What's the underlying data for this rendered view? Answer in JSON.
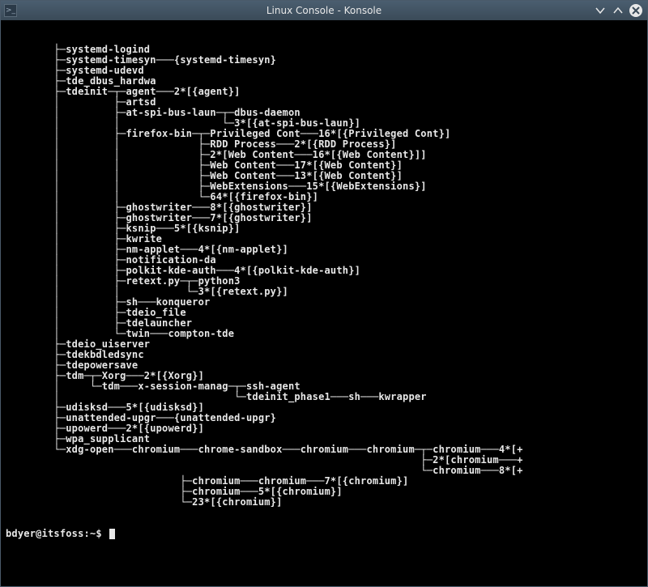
{
  "window": {
    "title": "Linux Console - Konsole",
    "icon_label": ">_"
  },
  "terminal": {
    "prompt": "bdyer@itsfoss:~$ ",
    "lines": [
      "        ├─systemd-logind",
      "        ├─systemd-timesyn───{systemd-timesyn}",
      "        ├─systemd-udevd",
      "        ├─tde_dbus_hardwa",
      "        ├─tdeinit─┬─agent───2*[{agent}]",
      "        │         ├─artsd",
      "        │         ├─at-spi-bus-laun─┬─dbus-daemon",
      "        │         │                 └─3*[{at-spi-bus-laun}]",
      "        │         ├─firefox-bin─┬─Privileged Cont───16*[{Privileged Cont}]",
      "        │         │             ├─RDD Process───2*[{RDD Process}]",
      "        │         │             ├─2*[Web Content───16*[{Web Content}]]",
      "        │         │             ├─Web Content───17*[{Web Content}]",
      "        │         │             ├─Web Content───13*[{Web Content}]",
      "        │         │             ├─WebExtensions───15*[{WebExtensions}]",
      "        │         │             └─64*[{firefox-bin}]",
      "        │         ├─ghostwriter───8*[{ghostwriter}]",
      "        │         ├─ghostwriter───7*[{ghostwriter}]",
      "        │         ├─ksnip───5*[{ksnip}]",
      "        │         ├─kwrite",
      "        │         ├─nm-applet───4*[{nm-applet}]",
      "        │         ├─notification-da",
      "        │         ├─polkit-kde-auth───4*[{polkit-kde-auth}]",
      "        │         ├─retext.py─┬─python3",
      "        │         │           └─3*[{retext.py}]",
      "        │         ├─sh───konqueror",
      "        │         ├─tdeio_file",
      "        │         ├─tdelauncher",
      "        │         └─twin───compton-tde",
      "        ├─tdeio_uiserver",
      "        ├─tdekbdledsync",
      "        ├─tdepowersave",
      "        ├─tdm─┬─Xorg───2*[{Xorg}]",
      "        │     └─tdm───x-session-manag─┬─ssh-agent",
      "        │                             └─tdeinit_phase1───sh───kwrapper",
      "        ├─udisksd───5*[{udisksd}]",
      "        ├─unattended-upgr───{unattended-upgr}",
      "        ├─upowerd───2*[{upowerd}]",
      "        ├─wpa_supplicant",
      "        └─xdg-open───chromium───chrome-sandbox───chromium───chromium─┬─chromium───4*[+",
      "                                                                     ├─2*[chromium───+",
      "                                                                     └─chromium───8*[+",
      "                             ├─chromium───chromium───7*[{chromium}]",
      "                             ├─chromium───5*[{chromium}]",
      "                             └─23*[{chromium}]"
    ]
  }
}
